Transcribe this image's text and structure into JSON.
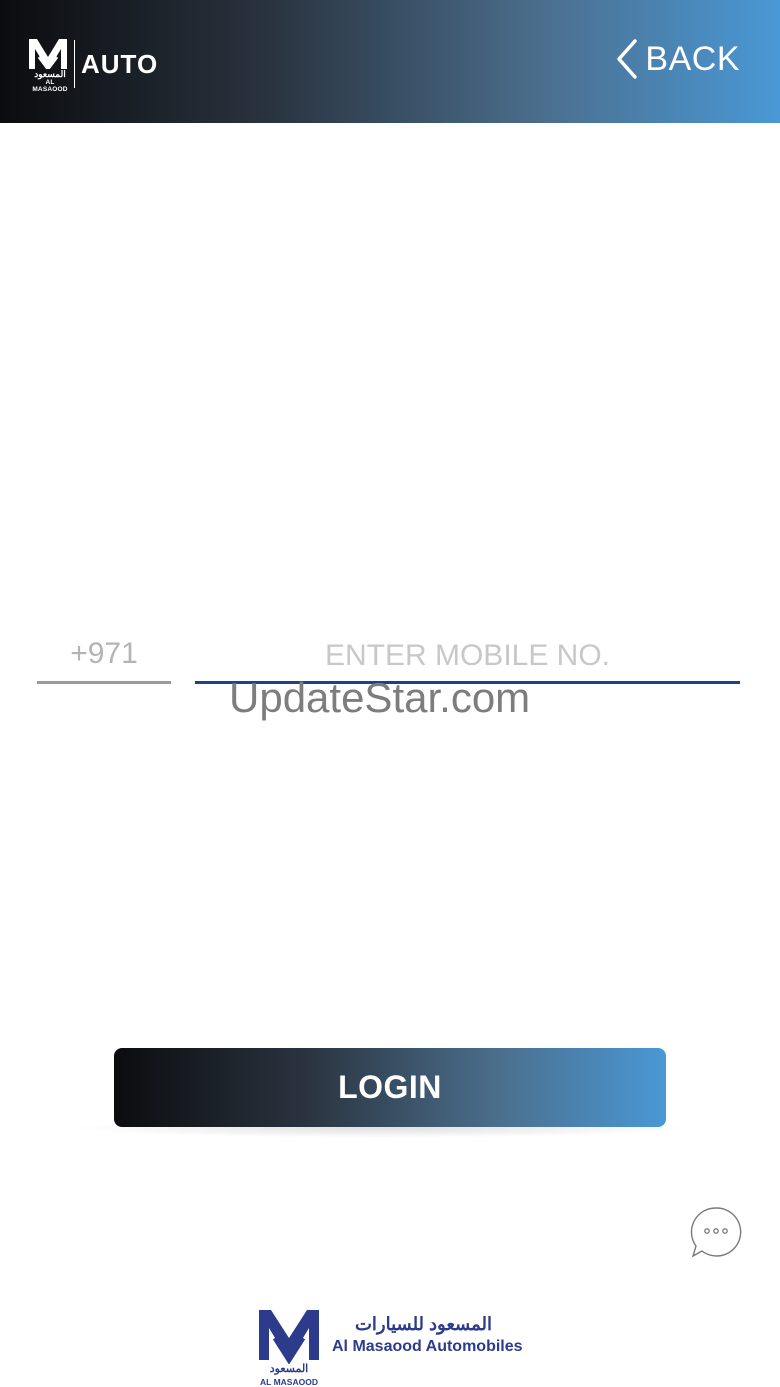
{
  "header": {
    "logo": {
      "arabic": "المسعود",
      "english": "AL MASAOOD",
      "product": "AUTO"
    },
    "back_label": "BACK"
  },
  "form": {
    "country_code": "+971",
    "mobile_placeholder": "ENTER MOBILE NO.",
    "mobile_value": ""
  },
  "watermark": "UpdateStar.com",
  "login_label": "LOGIN",
  "footer": {
    "logo_arabic": "المسعود",
    "logo_english": "AL MASAOOD",
    "company_arabic": "المسعود للسيارات",
    "company_english": "Al Masaood Automobiles"
  },
  "colors": {
    "gradient_start": "#0b0c0e",
    "gradient_end": "#4a98d6",
    "input_underline": "#223f8a",
    "country_underline": "#9a9a9a",
    "brand_blue": "#2d3b8c"
  },
  "icons": {
    "back": "chevron-left-icon",
    "chat": "chat-bubble-icon",
    "logo": "al-masaood-logo-icon"
  }
}
